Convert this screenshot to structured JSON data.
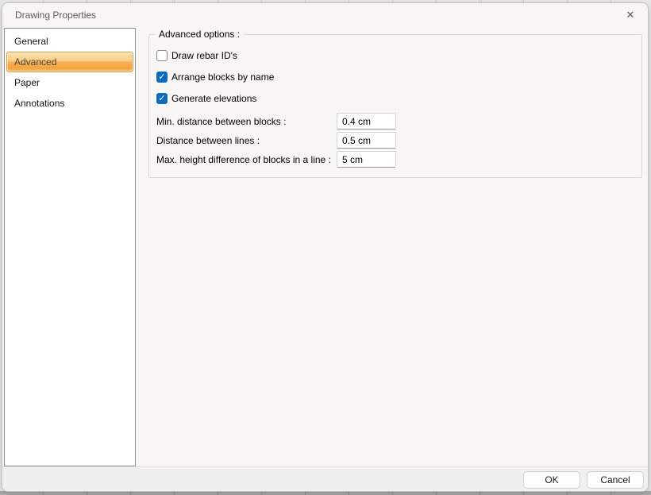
{
  "dialog": {
    "title": "Drawing Properties",
    "close_icon": "✕"
  },
  "sidebar": {
    "items": [
      {
        "label": "General",
        "selected": false
      },
      {
        "label": "Advanced",
        "selected": true
      },
      {
        "label": "Paper",
        "selected": false
      },
      {
        "label": "Annotations",
        "selected": false
      }
    ]
  },
  "main": {
    "group_title": "Advanced options :",
    "checkboxes": [
      {
        "label": "Draw rebar ID's",
        "checked": false
      },
      {
        "label": "Arrange blocks by name",
        "checked": true
      },
      {
        "label": "Generate elevations",
        "checked": true
      }
    ],
    "checkmark": "✓",
    "fields": [
      {
        "label": "Min. distance between blocks :",
        "value": "0.4 cm"
      },
      {
        "label": "Distance between lines :",
        "value": "0.5 cm"
      },
      {
        "label": "Max. height difference of blocks in a line :",
        "value": "5 cm"
      }
    ]
  },
  "footer": {
    "ok_label": "OK",
    "cancel_label": "Cancel"
  },
  "colors": {
    "checkbox_accent": "#0b6cbd",
    "selected_item_border": "#d29a3f",
    "selected_item_gradient_top": "#fde3ae",
    "selected_item_gradient_bottom": "#f4a43c",
    "dialog_background": "#f7f6f5",
    "footer_background": "#f0f0f0"
  }
}
